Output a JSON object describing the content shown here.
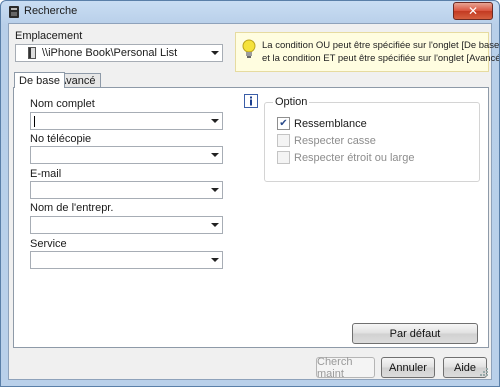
{
  "window": {
    "title": "Recherche"
  },
  "location": {
    "label": "Emplacement",
    "value": "\\\\iPhone Book\\Personal List"
  },
  "info": {
    "line1": "La condition OU peut être spécifiée sur l'onglet [De base]",
    "line2": "et la condition ET peut être spécifiée sur l'onglet [Avancé]."
  },
  "tabs": [
    {
      "label": "De base"
    },
    {
      "label": "Avancé"
    }
  ],
  "fields": [
    {
      "label": "Nom complet",
      "value": ""
    },
    {
      "label": "No télécopie",
      "value": ""
    },
    {
      "label": "E-mail",
      "value": ""
    },
    {
      "label": "Nom de l'entrepr.",
      "value": ""
    },
    {
      "label": "Service",
      "value": ""
    }
  ],
  "options": {
    "title": "Option",
    "items": [
      {
        "label": "Ressemblance",
        "checked": true,
        "enabled": true
      },
      {
        "label": "Respecter casse",
        "checked": false,
        "enabled": false
      },
      {
        "label": "Respecter étroit ou large",
        "checked": false,
        "enabled": false
      }
    ]
  },
  "buttons": {
    "default": "Par défaut",
    "search": "Cherch maint",
    "cancel": "Annuler",
    "help": "Aide"
  },
  "colors": {
    "info_bg": "#fffde0",
    "titlebar": "#c9ddf3",
    "close": "#d9533d"
  }
}
